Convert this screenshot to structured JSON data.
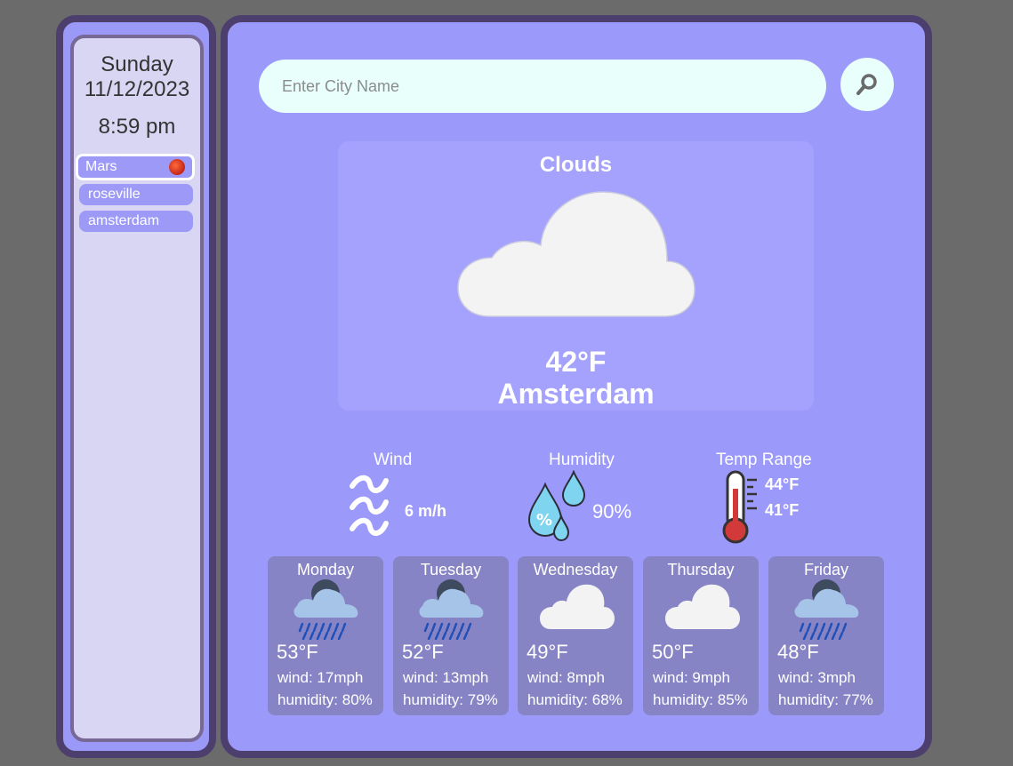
{
  "sidebar": {
    "day": "Sunday",
    "date": "11/12/2023",
    "time": "8:59 pm",
    "cities": [
      {
        "label": "Mars",
        "active": true,
        "icon": "mars-planet-icon"
      },
      {
        "label": "roseville",
        "active": false
      },
      {
        "label": "amsterdam",
        "active": false
      }
    ]
  },
  "search": {
    "placeholder": "Enter City Name",
    "button_icon": "search-icon"
  },
  "current": {
    "condition": "Clouds",
    "icon": "cloud-icon",
    "temp": "42°F",
    "city": "Amsterdam"
  },
  "stats": {
    "wind": {
      "label": "Wind",
      "value": "6 m/h",
      "icon": "wind-icon"
    },
    "humidity": {
      "label": "Humidity",
      "value": "90%",
      "icon": "humidity-icon"
    },
    "temp_range": {
      "label": "Temp Range",
      "high": "44°F",
      "low": "41°F",
      "icon": "thermometer-icon"
    }
  },
  "forecast": [
    {
      "day": "Monday",
      "icon": "rain-cloud-icon",
      "temp": "53°F",
      "wind": "wind: 17mph",
      "humidity": "humidity: 80%"
    },
    {
      "day": "Tuesday",
      "icon": "rain-cloud-icon",
      "temp": "52°F",
      "wind": "wind: 13mph",
      "humidity": "humidity: 79%"
    },
    {
      "day": "Wednesday",
      "icon": "cloud-icon",
      "temp": "49°F",
      "wind": "wind: 8mph",
      "humidity": "humidity: 68%"
    },
    {
      "day": "Thursday",
      "icon": "cloud-icon",
      "temp": "50°F",
      "wind": "wind: 9mph",
      "humidity": "humidity: 85%"
    },
    {
      "day": "Friday",
      "icon": "rain-cloud-icon",
      "temp": "48°F",
      "wind": "wind: 3mph",
      "humidity": "humidity: 77%"
    }
  ],
  "colors": {
    "background": "#6b6b6b",
    "panel": "#9b99fa",
    "panel_border": "#4c3f6e",
    "sidebar_inner": "#d8d6f2",
    "search_bg": "#e8fffb",
    "forecast_card": "#8784c6"
  }
}
